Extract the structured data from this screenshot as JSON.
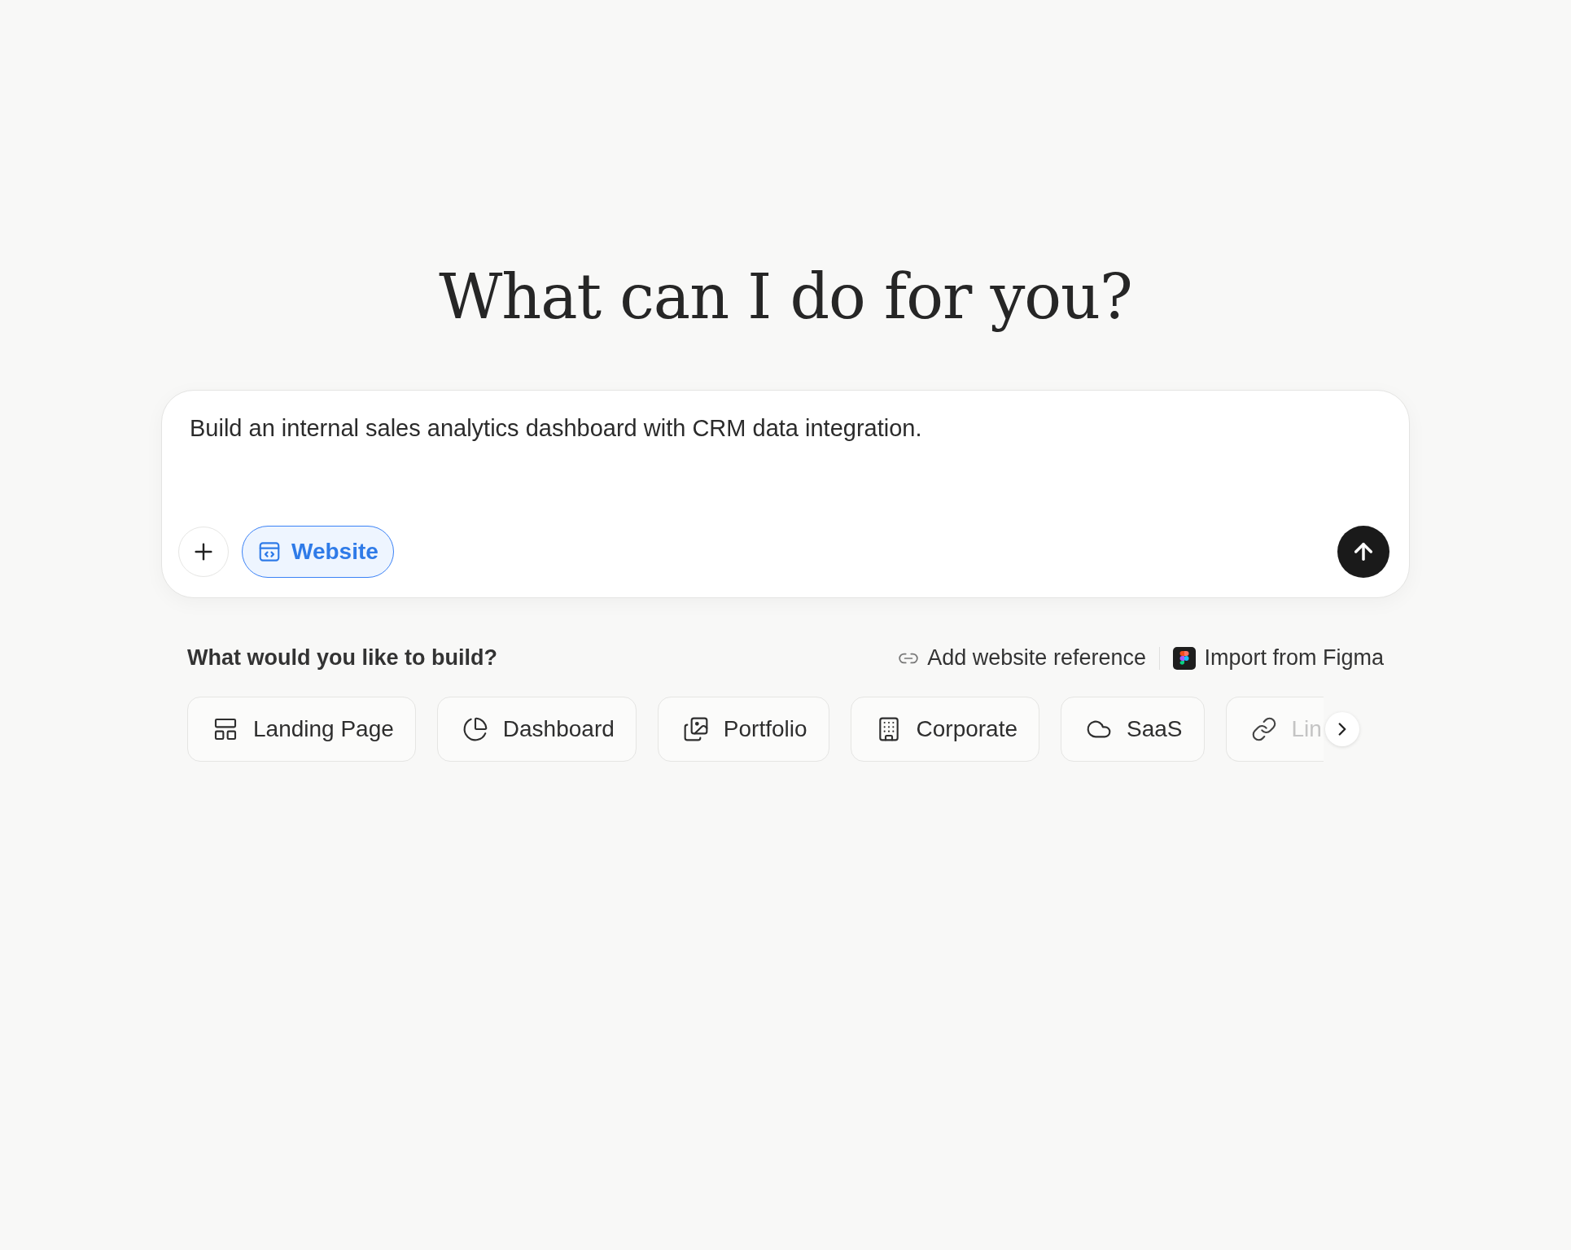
{
  "heading": "What can I do for you?",
  "prompt": {
    "value": "Build an internal sales analytics dashboard with CRM data integration.",
    "mode_chip": {
      "label": "Website",
      "selected": true
    }
  },
  "build_section": {
    "title": "What would you like to build?",
    "links": [
      "Add website reference",
      "Import from Figma"
    ],
    "categories": [
      {
        "label": "Landing Page"
      },
      {
        "label": "Dashboard"
      },
      {
        "label": "Portfolio"
      },
      {
        "label": "Corporate"
      },
      {
        "label": "SaaS"
      },
      {
        "label": "Lin"
      }
    ]
  }
}
